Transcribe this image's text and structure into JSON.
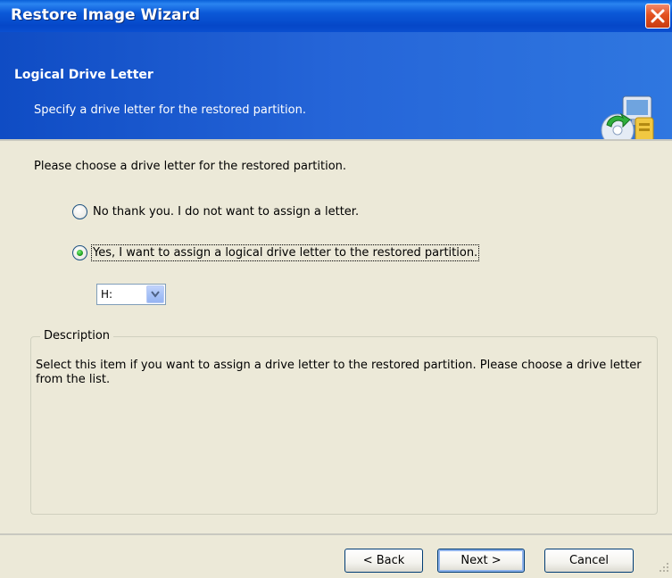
{
  "window": {
    "title": "Restore Image Wizard"
  },
  "header": {
    "title": "Logical Drive Letter",
    "subtitle": "Specify a drive letter for the restored partition."
  },
  "content": {
    "prompt": "Please choose a drive letter for the restored partition.",
    "options": [
      {
        "label": "No thank you. I do not want to assign a letter.",
        "checked": false
      },
      {
        "label": "Yes, I want to assign a logical drive letter to the restored partition.",
        "checked": true
      }
    ],
    "drive_letter": "H:",
    "description": {
      "legend": "Description",
      "text": "Select this item if you want to assign a drive letter to the restored partition. Please choose a drive letter from the list."
    }
  },
  "buttons": {
    "back": "< Back",
    "next": "Next >",
    "cancel": "Cancel"
  },
  "colors": {
    "titlebar": "#0a59d8",
    "header": "#2565d8",
    "dialog_bg": "#ece9d8",
    "close": "#e3521f"
  }
}
